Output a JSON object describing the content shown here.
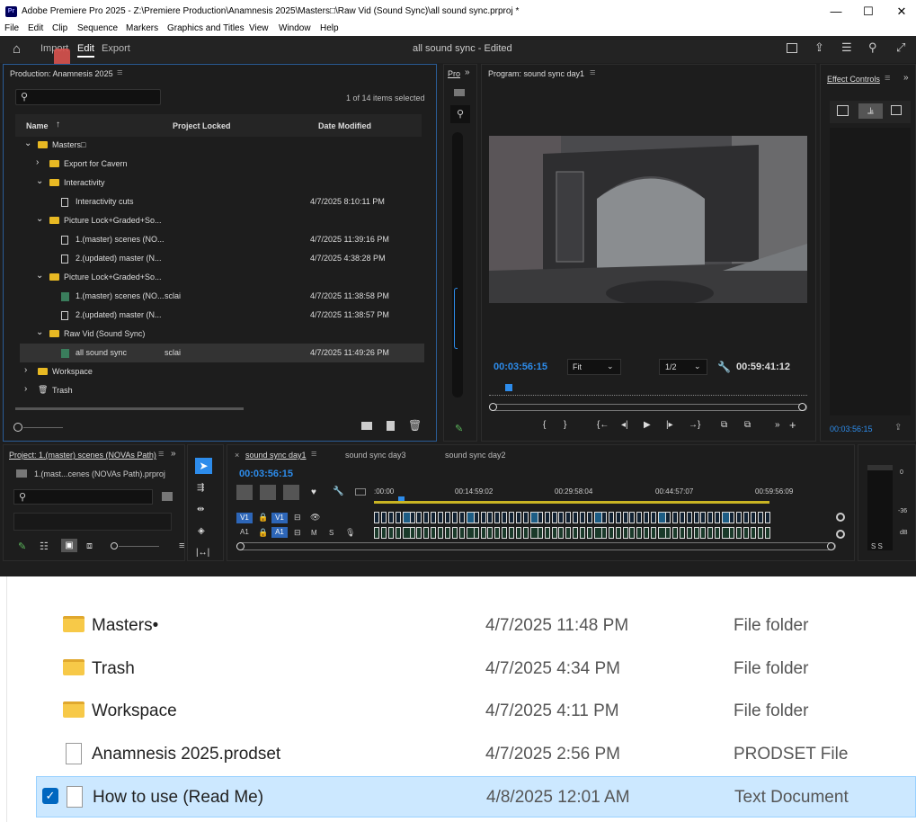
{
  "titlebar": {
    "logo": "Pr",
    "title": "Adobe Premiere Pro 2025 - Z:\\Premiere Production\\Anamnesis 2025\\Masters□\\Raw Vid (Sound Sync)\\all sound sync.prproj *",
    "minimize": "—",
    "maximize": "☐",
    "close": "✕"
  },
  "menu": [
    "File",
    "Edit",
    "Clip",
    "Sequence",
    "Markers",
    "Graphics and Titles",
    "View",
    "Window",
    "Help"
  ],
  "header": {
    "tabs": [
      "Import",
      "Edit",
      "Export"
    ],
    "document_title": "all sound sync - Edited"
  },
  "project_panel": {
    "title": "Production: Anamnesis 2025",
    "items_selected": "1 of 14 items selected",
    "columns": [
      "Name",
      "Project Locked",
      "Date Modified"
    ],
    "rows": [
      {
        "name": "Masters□",
        "locked": "",
        "date": "",
        "type": "folder",
        "indent": 0,
        "expanded": true
      },
      {
        "name": "Export for Cavern",
        "locked": "",
        "date": "",
        "type": "folder",
        "indent": 1,
        "expanded": false
      },
      {
        "name": "Interactivity",
        "locked": "",
        "date": "",
        "type": "folder",
        "indent": 1,
        "expanded": true
      },
      {
        "name": "Interactivity cuts",
        "locked": "",
        "date": "4/7/2025 8:10:11 PM",
        "type": "file",
        "indent": 2
      },
      {
        "name": "Picture Lock+Graded+So...",
        "locked": "",
        "date": "",
        "type": "folder",
        "indent": 1,
        "expanded": true
      },
      {
        "name": "1.(master) scenes (NO...",
        "locked": "",
        "date": "4/7/2025 11:39:16 PM",
        "type": "file",
        "indent": 2
      },
      {
        "name": "2.(updated) master (N...",
        "locked": "",
        "date": "4/7/2025 4:38:28 PM",
        "type": "file",
        "indent": 2
      },
      {
        "name": "Picture Lock+Graded+So...",
        "locked": "",
        "date": "",
        "type": "folder",
        "indent": 1,
        "expanded": true
      },
      {
        "name": "1.(master) scenes (NO...",
        "locked": "sclai",
        "date": "4/7/2025 11:38:58 PM",
        "type": "seq",
        "indent": 2
      },
      {
        "name": "2.(updated) master (N...",
        "locked": "",
        "date": "4/7/2025 11:38:57 PM",
        "type": "file",
        "indent": 2
      },
      {
        "name": "Raw Vid (Sound Sync)",
        "locked": "",
        "date": "",
        "type": "folder",
        "indent": 1,
        "expanded": true
      },
      {
        "name": "all sound sync",
        "locked": "sclai",
        "date": "4/7/2025 11:49:26 PM",
        "type": "seq",
        "indent": 2,
        "selected": true
      },
      {
        "name": "Workspace",
        "locked": "",
        "date": "",
        "type": "folder",
        "indent": 0,
        "expanded": false
      },
      {
        "name": "Trash",
        "locked": "",
        "date": "",
        "type": "trash",
        "indent": 0,
        "expanded": false
      }
    ]
  },
  "mini_panel": {
    "title": "Pro"
  },
  "program_monitor": {
    "title": "Program: sound sync day1",
    "current_time": "00:03:56:15",
    "fit": "Fit",
    "resolution": "1/2",
    "duration": "00:59:41:12"
  },
  "effect_controls": {
    "title": "Effect Controls",
    "time": "00:03:56:15"
  },
  "project2": {
    "title": "Project: 1.(master) scenes (NOVAs Path)",
    "file": "1.(mast...cenes (NOVAs Path).prproj"
  },
  "timeline": {
    "tabs": [
      "sound sync day1",
      "sound sync day3",
      "sound sync day2"
    ],
    "timecode": "00:03:56:15",
    "ruler": [
      ":00:00",
      "00:14:59:02",
      "00:29:58:04",
      "00:44:57:07",
      "00:59:56:09"
    ],
    "tracks": {
      "v1": "V1",
      "a1": "A1",
      "m": "M",
      "s": "S"
    }
  },
  "meter": {
    "labels": [
      "0",
      "-36",
      "dB"
    ],
    "solo": "S S"
  },
  "explorer": {
    "rows": [
      {
        "name": "Masters•",
        "date": "4/7/2025 11:48 PM",
        "type": "File folder",
        "icon": "folder"
      },
      {
        "name": "Trash",
        "date": "4/7/2025 4:34 PM",
        "type": "File folder",
        "icon": "folder"
      },
      {
        "name": "Workspace",
        "date": "4/7/2025 4:11 PM",
        "type": "File folder",
        "icon": "folder"
      },
      {
        "name": "Anamnesis 2025.prodset",
        "date": "4/7/2025 2:56 PM",
        "type": "PRODSET File",
        "icon": "file"
      },
      {
        "name": "How to use (Read Me)",
        "date": "4/8/2025 12:01 AM",
        "type": "Text Document",
        "icon": "textfile",
        "selected": true
      }
    ]
  }
}
